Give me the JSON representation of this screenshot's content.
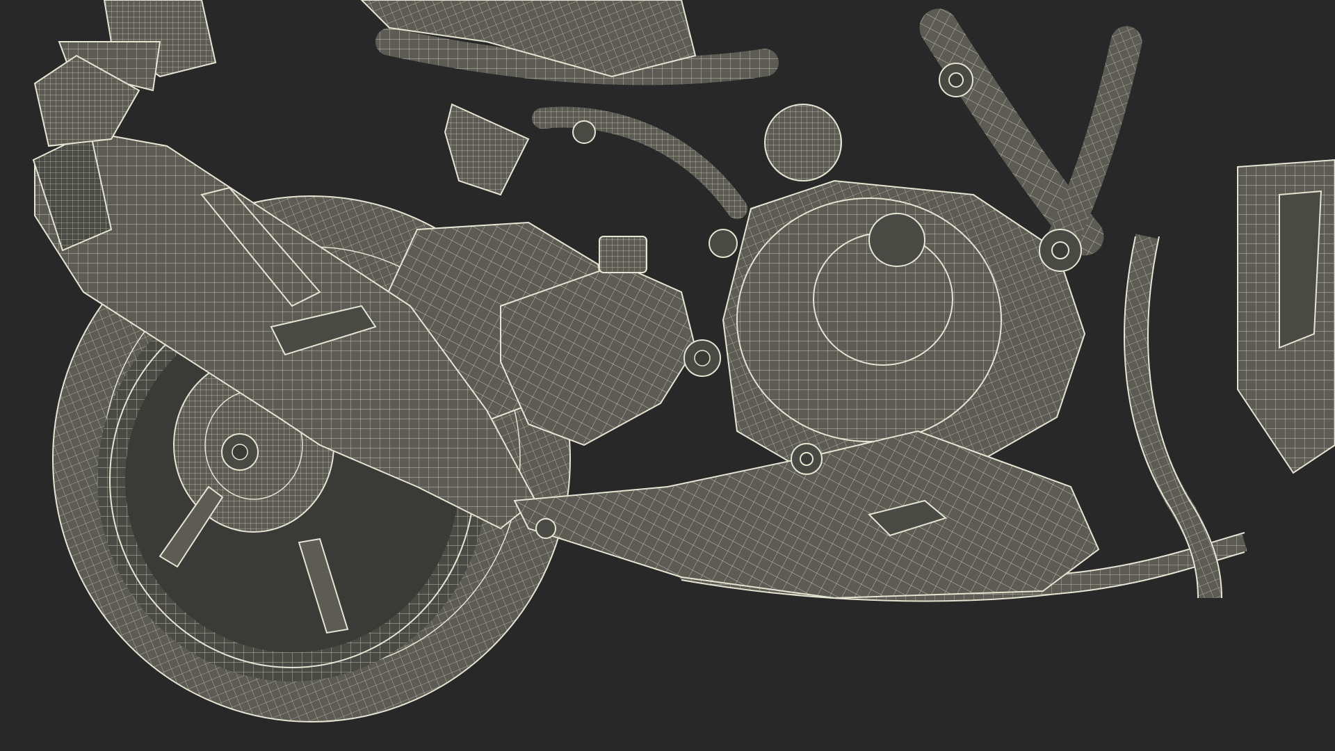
{
  "scene": {
    "subject": "motorcycle-rear-wireframe-render",
    "background_color": "#282828",
    "surface_color": "#5c5c55",
    "surface_shade_color": "#4a4a44",
    "wire_color": "#e6e4d2"
  }
}
